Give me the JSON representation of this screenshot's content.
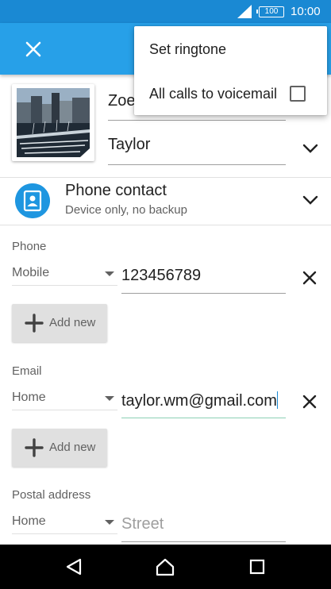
{
  "status_bar": {
    "battery": "100",
    "time": "10:00"
  },
  "contact": {
    "first_name": "Zoe",
    "last_name": "Taylor"
  },
  "account": {
    "title": "Phone contact",
    "subtitle": "Device only, no backup"
  },
  "phone": {
    "label": "Phone",
    "type": "Mobile",
    "value": "123456789",
    "add_label": "Add new"
  },
  "email": {
    "label": "Email",
    "type": "Home",
    "value": "taylor.wm@gmail.com",
    "add_label": "Add new"
  },
  "postal": {
    "label": "Postal address",
    "type": "Home",
    "street_placeholder": "Street"
  },
  "menu": {
    "items": [
      {
        "label": "Set ringtone",
        "checked": false
      },
      {
        "label": "All calls to voicemail",
        "checked": false
      }
    ]
  },
  "colors": {
    "status_bar": "#1a89d3",
    "app_bar": "#27a0e8",
    "account_badge": "#1e96e0",
    "focus_underline": "#8ccfb5"
  },
  "icons": [
    "signal-icon",
    "battery-icon",
    "close-icon",
    "chevron-down-icon",
    "contact-card-icon",
    "clear-icon",
    "plus-icon",
    "back-icon",
    "home-icon",
    "recents-icon"
  ]
}
